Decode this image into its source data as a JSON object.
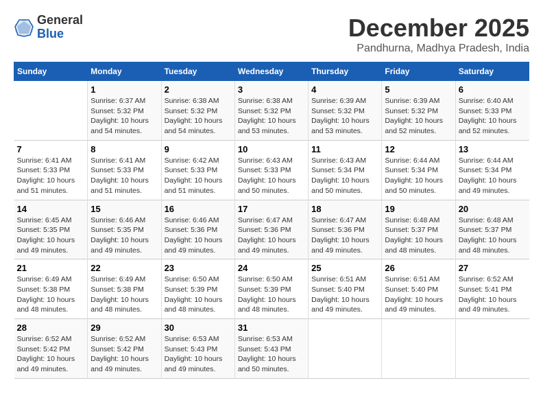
{
  "logo": {
    "general": "General",
    "blue": "Blue"
  },
  "header": {
    "month": "December 2025",
    "location": "Pandhurna, Madhya Pradesh, India"
  },
  "days_of_week": [
    "Sunday",
    "Monday",
    "Tuesday",
    "Wednesday",
    "Thursday",
    "Friday",
    "Saturday"
  ],
  "weeks": [
    [
      {
        "day": "",
        "info": ""
      },
      {
        "day": "1",
        "info": "Sunrise: 6:37 AM\nSunset: 5:32 PM\nDaylight: 10 hours\nand 54 minutes."
      },
      {
        "day": "2",
        "info": "Sunrise: 6:38 AM\nSunset: 5:32 PM\nDaylight: 10 hours\nand 54 minutes."
      },
      {
        "day": "3",
        "info": "Sunrise: 6:38 AM\nSunset: 5:32 PM\nDaylight: 10 hours\nand 53 minutes."
      },
      {
        "day": "4",
        "info": "Sunrise: 6:39 AM\nSunset: 5:32 PM\nDaylight: 10 hours\nand 53 minutes."
      },
      {
        "day": "5",
        "info": "Sunrise: 6:39 AM\nSunset: 5:32 PM\nDaylight: 10 hours\nand 52 minutes."
      },
      {
        "day": "6",
        "info": "Sunrise: 6:40 AM\nSunset: 5:33 PM\nDaylight: 10 hours\nand 52 minutes."
      }
    ],
    [
      {
        "day": "7",
        "info": "Sunrise: 6:41 AM\nSunset: 5:33 PM\nDaylight: 10 hours\nand 51 minutes."
      },
      {
        "day": "8",
        "info": "Sunrise: 6:41 AM\nSunset: 5:33 PM\nDaylight: 10 hours\nand 51 minutes."
      },
      {
        "day": "9",
        "info": "Sunrise: 6:42 AM\nSunset: 5:33 PM\nDaylight: 10 hours\nand 51 minutes."
      },
      {
        "day": "10",
        "info": "Sunrise: 6:43 AM\nSunset: 5:33 PM\nDaylight: 10 hours\nand 50 minutes."
      },
      {
        "day": "11",
        "info": "Sunrise: 6:43 AM\nSunset: 5:34 PM\nDaylight: 10 hours\nand 50 minutes."
      },
      {
        "day": "12",
        "info": "Sunrise: 6:44 AM\nSunset: 5:34 PM\nDaylight: 10 hours\nand 50 minutes."
      },
      {
        "day": "13",
        "info": "Sunrise: 6:44 AM\nSunset: 5:34 PM\nDaylight: 10 hours\nand 49 minutes."
      }
    ],
    [
      {
        "day": "14",
        "info": "Sunrise: 6:45 AM\nSunset: 5:35 PM\nDaylight: 10 hours\nand 49 minutes."
      },
      {
        "day": "15",
        "info": "Sunrise: 6:46 AM\nSunset: 5:35 PM\nDaylight: 10 hours\nand 49 minutes."
      },
      {
        "day": "16",
        "info": "Sunrise: 6:46 AM\nSunset: 5:36 PM\nDaylight: 10 hours\nand 49 minutes."
      },
      {
        "day": "17",
        "info": "Sunrise: 6:47 AM\nSunset: 5:36 PM\nDaylight: 10 hours\nand 49 minutes."
      },
      {
        "day": "18",
        "info": "Sunrise: 6:47 AM\nSunset: 5:36 PM\nDaylight: 10 hours\nand 49 minutes."
      },
      {
        "day": "19",
        "info": "Sunrise: 6:48 AM\nSunset: 5:37 PM\nDaylight: 10 hours\nand 48 minutes."
      },
      {
        "day": "20",
        "info": "Sunrise: 6:48 AM\nSunset: 5:37 PM\nDaylight: 10 hours\nand 48 minutes."
      }
    ],
    [
      {
        "day": "21",
        "info": "Sunrise: 6:49 AM\nSunset: 5:38 PM\nDaylight: 10 hours\nand 48 minutes."
      },
      {
        "day": "22",
        "info": "Sunrise: 6:49 AM\nSunset: 5:38 PM\nDaylight: 10 hours\nand 48 minutes."
      },
      {
        "day": "23",
        "info": "Sunrise: 6:50 AM\nSunset: 5:39 PM\nDaylight: 10 hours\nand 48 minutes."
      },
      {
        "day": "24",
        "info": "Sunrise: 6:50 AM\nSunset: 5:39 PM\nDaylight: 10 hours\nand 48 minutes."
      },
      {
        "day": "25",
        "info": "Sunrise: 6:51 AM\nSunset: 5:40 PM\nDaylight: 10 hours\nand 49 minutes."
      },
      {
        "day": "26",
        "info": "Sunrise: 6:51 AM\nSunset: 5:40 PM\nDaylight: 10 hours\nand 49 minutes."
      },
      {
        "day": "27",
        "info": "Sunrise: 6:52 AM\nSunset: 5:41 PM\nDaylight: 10 hours\nand 49 minutes."
      }
    ],
    [
      {
        "day": "28",
        "info": "Sunrise: 6:52 AM\nSunset: 5:42 PM\nDaylight: 10 hours\nand 49 minutes."
      },
      {
        "day": "29",
        "info": "Sunrise: 6:52 AM\nSunset: 5:42 PM\nDaylight: 10 hours\nand 49 minutes."
      },
      {
        "day": "30",
        "info": "Sunrise: 6:53 AM\nSunset: 5:43 PM\nDaylight: 10 hours\nand 49 minutes."
      },
      {
        "day": "31",
        "info": "Sunrise: 6:53 AM\nSunset: 5:43 PM\nDaylight: 10 hours\nand 50 minutes."
      },
      {
        "day": "",
        "info": ""
      },
      {
        "day": "",
        "info": ""
      },
      {
        "day": "",
        "info": ""
      }
    ]
  ]
}
